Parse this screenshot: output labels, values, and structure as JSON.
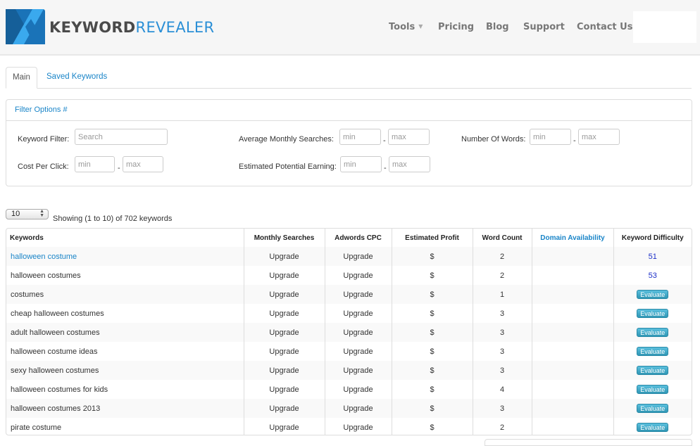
{
  "brand": {
    "name_bold": "KEYWORD",
    "name_light": "REVEALER",
    "colors": {
      "dark": "#1a73b8",
      "light": "#3aa9ee",
      "text_dark": "#4a4a4a",
      "text_blue": "#2b8fd6"
    }
  },
  "nav": {
    "items": [
      {
        "label": "Tools",
        "has_caret": true
      },
      {
        "label": "Pricing"
      },
      {
        "label": "Blog"
      },
      {
        "label": "Support"
      },
      {
        "label": "Contact Us"
      }
    ]
  },
  "tabs": [
    {
      "label": "Main",
      "active": true
    },
    {
      "label": "Saved Keywords",
      "active": false
    }
  ],
  "filter": {
    "title": "Filter Options #",
    "keyword_filter": {
      "label": "Keyword Filter:",
      "placeholder": "Search"
    },
    "avg_monthly_searches": {
      "label": "Average Monthly Searches:",
      "min_placeholder": "min",
      "max_placeholder": "max"
    },
    "number_of_words": {
      "label": "Number Of Words:",
      "min_placeholder": "min",
      "max_placeholder": "max"
    },
    "cost_per_click": {
      "label": "Cost Per Click:",
      "min_placeholder": "min",
      "max_placeholder": "max"
    },
    "est_potential_earning": {
      "label": "Estimated Potential Earning:",
      "min_placeholder": "min",
      "max_placeholder": "max"
    },
    "separator": "-"
  },
  "length_select": {
    "value": "10",
    "arrows": "▲▼"
  },
  "showing_text": "Showing (1 to 10) of 702 keywords",
  "table": {
    "columns": [
      "Keywords",
      "Monthly Searches",
      "Adwords CPC",
      "Estimated Profit",
      "Word Count",
      "Domain Availability",
      "Keyword Difficulty"
    ],
    "rows": [
      {
        "keyword": "halloween costume",
        "monthly": "Upgrade",
        "cpc": "Upgrade",
        "profit": "$",
        "words": "2",
        "domain": "",
        "difficulty": "51"
      },
      {
        "keyword": "halloween costumes",
        "monthly": "Upgrade",
        "cpc": "Upgrade",
        "profit": "$",
        "words": "2",
        "domain": "",
        "difficulty": "53"
      },
      {
        "keyword": "costumes",
        "monthly": "Upgrade",
        "cpc": "Upgrade",
        "profit": "$",
        "words": "1",
        "domain": "",
        "difficulty": "Evaluate"
      },
      {
        "keyword": "cheap halloween costumes",
        "monthly": "Upgrade",
        "cpc": "Upgrade",
        "profit": "$",
        "words": "3",
        "domain": "",
        "difficulty": "Evaluate"
      },
      {
        "keyword": "adult halloween costumes",
        "monthly": "Upgrade",
        "cpc": "Upgrade",
        "profit": "$",
        "words": "3",
        "domain": "",
        "difficulty": "Evaluate"
      },
      {
        "keyword": "halloween costume ideas",
        "monthly": "Upgrade",
        "cpc": "Upgrade",
        "profit": "$",
        "words": "3",
        "domain": "",
        "difficulty": "Evaluate"
      },
      {
        "keyword": "sexy halloween costumes",
        "monthly": "Upgrade",
        "cpc": "Upgrade",
        "profit": "$",
        "words": "3",
        "domain": "",
        "difficulty": "Evaluate"
      },
      {
        "keyword": "halloween costumes for kids",
        "monthly": "Upgrade",
        "cpc": "Upgrade",
        "profit": "$",
        "words": "4",
        "domain": "",
        "difficulty": "Evaluate"
      },
      {
        "keyword": "halloween costumes 2013",
        "monthly": "Upgrade",
        "cpc": "Upgrade",
        "profit": "$",
        "words": "3",
        "domain": "",
        "difficulty": "Evaluate"
      },
      {
        "keyword": "pirate costume",
        "monthly": "Upgrade",
        "cpc": "Upgrade",
        "profit": "$",
        "words": "2",
        "domain": "",
        "difficulty": "Evaluate"
      }
    ]
  }
}
